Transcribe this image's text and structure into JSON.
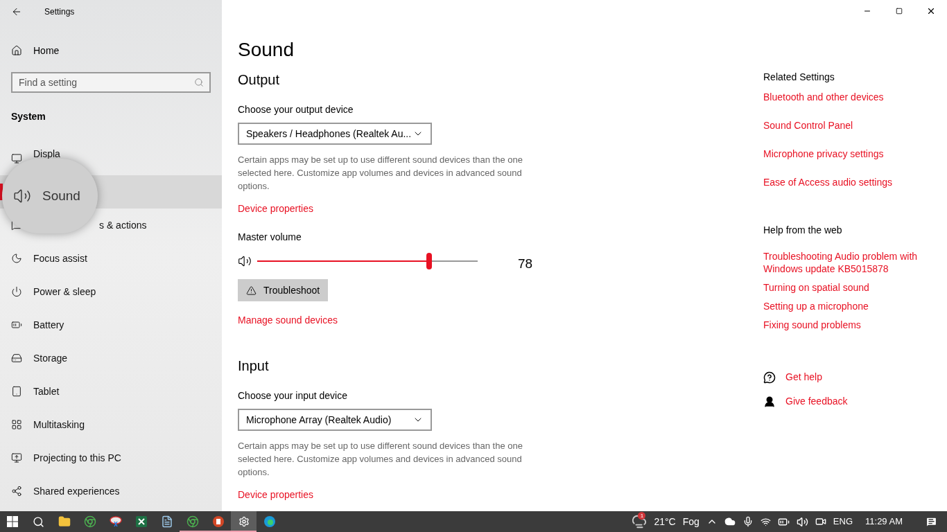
{
  "window": {
    "title": "Settings"
  },
  "sidebar": {
    "home": "Home",
    "search": {
      "placeholder": "Find a setting"
    },
    "section": "System",
    "items": [
      {
        "label": "Displa",
        "selected": false
      },
      {
        "label": "Sound",
        "selected": true
      },
      {
        "label": "s & actions",
        "selected": false
      },
      {
        "label": "Focus assist",
        "selected": false
      },
      {
        "label": "Power & sleep",
        "selected": false
      },
      {
        "label": "Battery",
        "selected": false
      },
      {
        "label": "Storage",
        "selected": false
      },
      {
        "label": "Tablet",
        "selected": false
      },
      {
        "label": "Multitasking",
        "selected": false
      },
      {
        "label": "Projecting to this PC",
        "selected": false
      },
      {
        "label": "Shared experiences",
        "selected": false
      }
    ]
  },
  "page": {
    "title": "Sound",
    "output": {
      "heading": "Output",
      "device_label": "Choose your output device",
      "device": "Speakers / Headphones (Realtek Au...",
      "note": "Certain apps may be set up to use different sound devices than the one selected here. Customize app volumes and devices in advanced sound options.",
      "link": "Device properties",
      "volume_label": "Master volume",
      "volume": {
        "level": 0.78,
        "reading": "78"
      },
      "troubleshoot": "Troubleshoot",
      "manage": "Manage sound devices"
    },
    "input": {
      "heading": "Input",
      "device_label": "Choose your input device",
      "device": "Microphone Array (Realtek Audio)",
      "note": "Certain apps may be set up to use different sound devices than the one selected here. Customize app volumes and devices in advanced sound options.",
      "link": "Device properties"
    }
  },
  "related": {
    "heading": "Related Settings",
    "links": [
      "Bluetooth and other devices",
      "Sound Control Panel",
      "Microphone privacy settings",
      "Ease of Access audio settings"
    ]
  },
  "help": {
    "heading": "Help from the web",
    "links": [
      "Troubleshooting Audio problem with Windows update KB5015878",
      "Turning on spatial sound",
      "Setting up a microphone",
      "Fixing sound problems"
    ]
  },
  "support": [
    {
      "kind": "help",
      "label": "Get help"
    },
    {
      "kind": "feedback",
      "label": "Give feedback"
    }
  ],
  "taskbar": {
    "apps": [
      {
        "kind": "explorer",
        "running": false,
        "selected": false
      },
      {
        "kind": "chrome",
        "running": false,
        "selected": false
      },
      {
        "kind": "snip",
        "running": false,
        "selected": false
      },
      {
        "kind": "excel",
        "running": false,
        "selected": false
      },
      {
        "kind": "notepad",
        "running": false,
        "selected": false
      },
      {
        "kind": "chrome2",
        "running": true,
        "selected": false
      },
      {
        "kind": "powerpoint",
        "running": true,
        "selected": false
      },
      {
        "kind": "settings",
        "running": true,
        "selected": true
      },
      {
        "kind": "edge",
        "running": false,
        "selected": false
      }
    ],
    "weather": {
      "badge": "1",
      "temp": "21°C",
      "condition": "Fog"
    },
    "language": "ENG",
    "time": "11:29 AM"
  }
}
